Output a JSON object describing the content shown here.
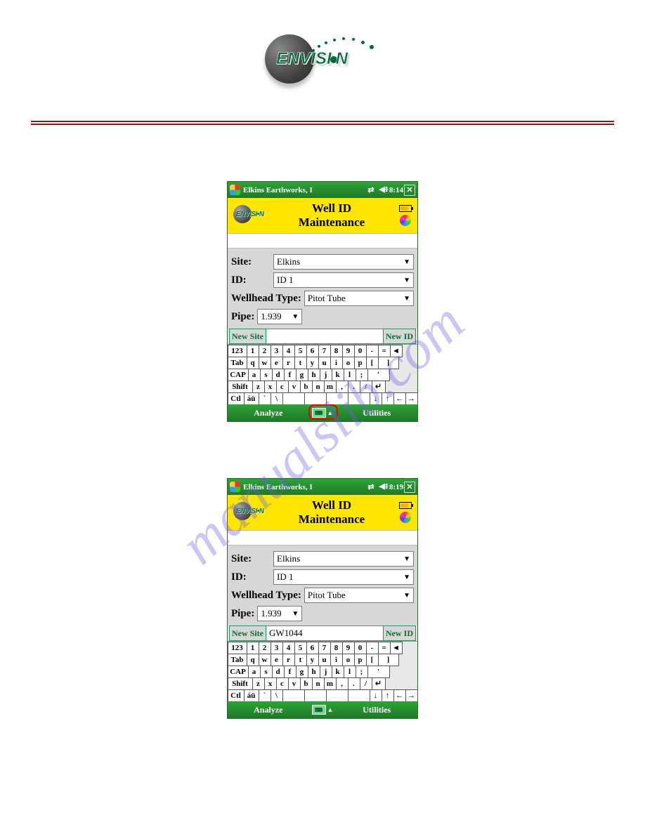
{
  "logo": {
    "brand": "ENVISI",
    "brand_suffix": "N"
  },
  "watermark": "manualslib.com",
  "screens": [
    {
      "titlebar": {
        "app": "Elkins Earthworks, I",
        "time": "8:14"
      },
      "header": {
        "line1": "Well ID",
        "line2": "Maintenance"
      },
      "form": {
        "site_label": "Site:",
        "site_value": "Elkins",
        "id_label": "ID:",
        "id_value": "ID 1",
        "wellhead_label": "Wellhead Type:",
        "wellhead_value": "Pitot Tube",
        "pipe_label": "Pipe:",
        "pipe_value": "1.939",
        "new_site_btn": "New Site",
        "new_site_input": "",
        "new_id_btn": "New ID"
      },
      "bottombar": {
        "left": "Analyze",
        "right": "Utilities"
      },
      "highlight_center": true
    },
    {
      "titlebar": {
        "app": "Elkins Earthworks, I",
        "time": "8:19"
      },
      "header": {
        "line1": "Well ID",
        "line2": "Maintenance"
      },
      "form": {
        "site_label": "Site:",
        "site_value": "Elkins",
        "id_label": "ID:",
        "id_value": "ID 1",
        "wellhead_label": "Wellhead Type:",
        "wellhead_value": "Pitot Tube",
        "pipe_label": "Pipe:",
        "pipe_value": "1.939",
        "new_site_btn": "New Site",
        "new_site_input": "GW1044",
        "new_id_btn": "New ID"
      },
      "bottombar": {
        "left": "Analyze",
        "right": "Utilities"
      },
      "highlight_center": false
    }
  ],
  "keyboard": {
    "row1": [
      "123",
      "1",
      "2",
      "3",
      "4",
      "5",
      "6",
      "7",
      "8",
      "9",
      "0",
      "-",
      "=",
      "◄"
    ],
    "row2": [
      "Tab",
      "q",
      "w",
      "e",
      "r",
      "t",
      "y",
      "u",
      "i",
      "o",
      "p",
      "[",
      "]"
    ],
    "row3": [
      "CAP",
      "a",
      "s",
      "d",
      "f",
      "g",
      "h",
      "j",
      "k",
      "l",
      ";",
      "'"
    ],
    "row4": [
      "Shift",
      "z",
      "x",
      "c",
      "v",
      "b",
      "n",
      "m",
      ",",
      ".",
      "/",
      "↵"
    ],
    "row5": [
      "Ctl",
      "áü",
      "`",
      "\\",
      " ",
      " ",
      " ",
      " ",
      "↓",
      "↑",
      "←",
      "→"
    ]
  }
}
